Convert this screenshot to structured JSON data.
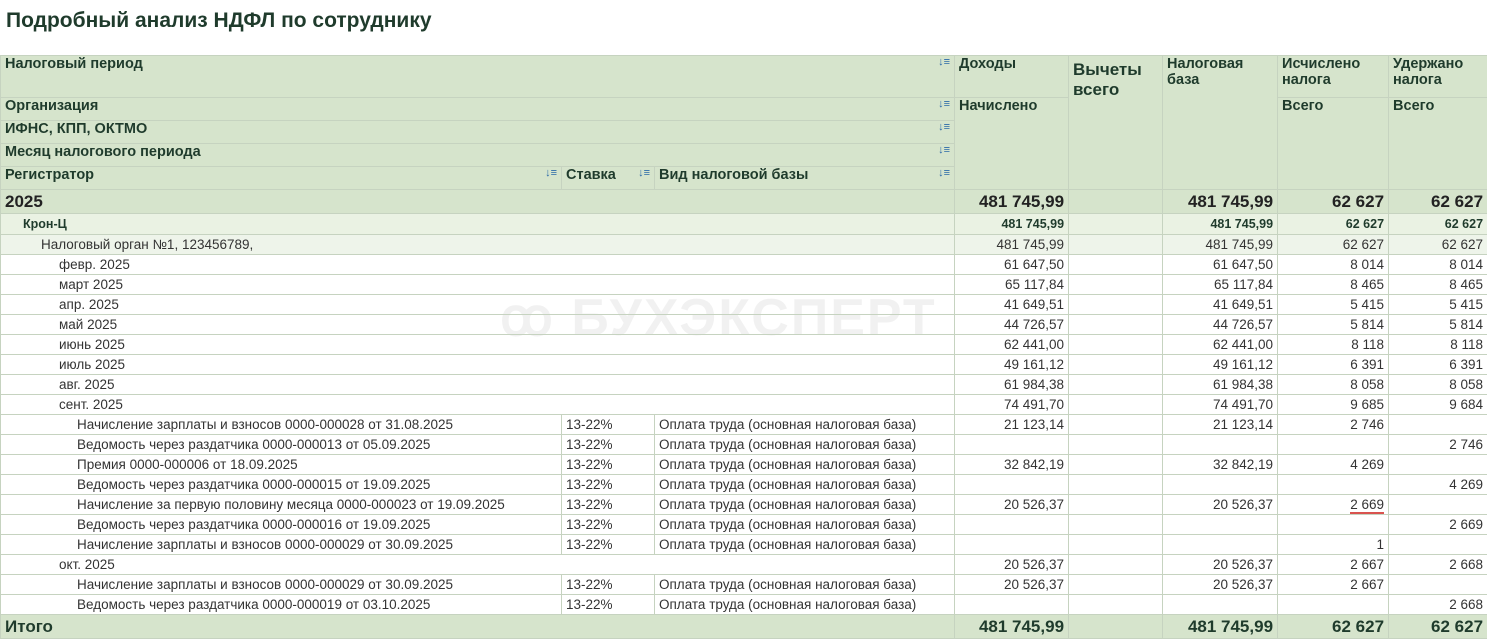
{
  "title": "Подробный анализ НДФЛ по сотруднику",
  "watermark": "БУХЭКСПЕРТ",
  "accent_color": "#d6e4cc",
  "header": {
    "tax_period": "Налоговый период",
    "organization": "Организация",
    "ifns": "ИФНС, КПП, ОКТМО",
    "month": "Месяц налогового периода",
    "registrar": "Регистратор",
    "rate": "Ставка",
    "base_kind": "Вид налоговой базы",
    "income": "Доходы",
    "income_sub": "Начислено",
    "deductions": "Вычеты всего",
    "tax_base": "Налоговая база",
    "calculated": "Исчислено налога",
    "calculated_sub": "Всего",
    "withheld": "Удержано налога",
    "withheld_sub": "Всего",
    "sort_icon": "sort-icon"
  },
  "rows": [
    {
      "type": "year",
      "label": "2025",
      "v": [
        "481 745,99",
        "",
        "481 745,99",
        "62 627",
        "62 627"
      ]
    },
    {
      "type": "org",
      "label": "Крон-Ц",
      "v": [
        "481 745,99",
        "",
        "481 745,99",
        "62 627",
        "62 627"
      ]
    },
    {
      "type": "ifns",
      "label": "Налоговый орган №1, 123456789,",
      "v": [
        "481 745,99",
        "",
        "481 745,99",
        "62 627",
        "62 627"
      ]
    },
    {
      "type": "month",
      "label": "февр. 2025",
      "v": [
        "61 647,50",
        "",
        "61 647,50",
        "8 014",
        "8 014"
      ]
    },
    {
      "type": "month",
      "label": "март 2025",
      "v": [
        "65 117,84",
        "",
        "65 117,84",
        "8 465",
        "8 465"
      ]
    },
    {
      "type": "month",
      "label": "апр. 2025",
      "v": [
        "41 649,51",
        "",
        "41 649,51",
        "5 415",
        "5 415"
      ]
    },
    {
      "type": "month",
      "label": "май 2025",
      "v": [
        "44 726,57",
        "",
        "44 726,57",
        "5 814",
        "5 814"
      ]
    },
    {
      "type": "month",
      "label": "июнь 2025",
      "v": [
        "62 441,00",
        "",
        "62 441,00",
        "8 118",
        "8 118"
      ]
    },
    {
      "type": "month",
      "label": "июль 2025",
      "v": [
        "49 161,12",
        "",
        "49 161,12",
        "6 391",
        "6 391"
      ]
    },
    {
      "type": "month",
      "label": "авг. 2025",
      "v": [
        "61 984,38",
        "",
        "61 984,38",
        "8 058",
        "8 058"
      ]
    },
    {
      "type": "month",
      "label": "сент. 2025",
      "v": [
        "74 491,70",
        "",
        "74 491,70",
        "9 685",
        "9 684"
      ]
    },
    {
      "type": "doc",
      "label": "Начисление зарплаты и взносов 0000-000028 от 31.08.2025",
      "rate": "13-22%",
      "kind": "Оплата труда (основная налоговая база)",
      "v": [
        "21 123,14",
        "",
        "21 123,14",
        "2 746",
        ""
      ]
    },
    {
      "type": "doc",
      "label": "Ведомость через раздатчика 0000-000013 от 05.09.2025",
      "rate": "13-22%",
      "kind": "Оплата труда (основная налоговая база)",
      "v": [
        "",
        "",
        "",
        "",
        "2 746"
      ]
    },
    {
      "type": "doc",
      "label": "Премия 0000-000006 от 18.09.2025",
      "rate": "13-22%",
      "kind": "Оплата труда (основная налоговая база)",
      "v": [
        "32 842,19",
        "",
        "32 842,19",
        "4 269",
        ""
      ]
    },
    {
      "type": "doc",
      "label": "Ведомость через раздатчика 0000-000015 от 19.09.2025",
      "rate": "13-22%",
      "kind": "Оплата труда (основная налоговая база)",
      "v": [
        "",
        "",
        "",
        "",
        "4 269"
      ]
    },
    {
      "type": "doc",
      "label": "Начисление за первую половину месяца 0000-000023 от 19.09.2025",
      "rate": "13-22%",
      "kind": "Оплата труда (основная налоговая база)",
      "v": [
        "20 526,37",
        "",
        "20 526,37",
        "2 669",
        ""
      ],
      "highlight": 3
    },
    {
      "type": "doc",
      "label": "Ведомость через раздатчика 0000-000016 от 19.09.2025",
      "rate": "13-22%",
      "kind": "Оплата труда (основная налоговая база)",
      "v": [
        "",
        "",
        "",
        "",
        "2 669"
      ]
    },
    {
      "type": "doc",
      "label": "Начисление зарплаты и взносов 0000-000029 от 30.09.2025",
      "rate": "13-22%",
      "kind": "Оплата труда (основная налоговая база)",
      "v": [
        "",
        "",
        "",
        "1",
        ""
      ]
    },
    {
      "type": "month",
      "label": "окт. 2025",
      "v": [
        "20 526,37",
        "",
        "20 526,37",
        "2 667",
        "2 668"
      ]
    },
    {
      "type": "doc",
      "label": "Начисление зарплаты и взносов 0000-000029 от 30.09.2025",
      "rate": "13-22%",
      "kind": "Оплата труда (основная налоговая база)",
      "v": [
        "20 526,37",
        "",
        "20 526,37",
        "2 667",
        ""
      ]
    },
    {
      "type": "doc",
      "label": "Ведомость через раздатчика 0000-000019 от 03.10.2025",
      "rate": "13-22%",
      "kind": "Оплата труда (основная налоговая база)",
      "v": [
        "",
        "",
        "",
        "",
        "2 668"
      ]
    },
    {
      "type": "total",
      "label": "Итого",
      "v": [
        "481 745,99",
        "",
        "481 745,99",
        "62 627",
        "62 627"
      ]
    }
  ]
}
